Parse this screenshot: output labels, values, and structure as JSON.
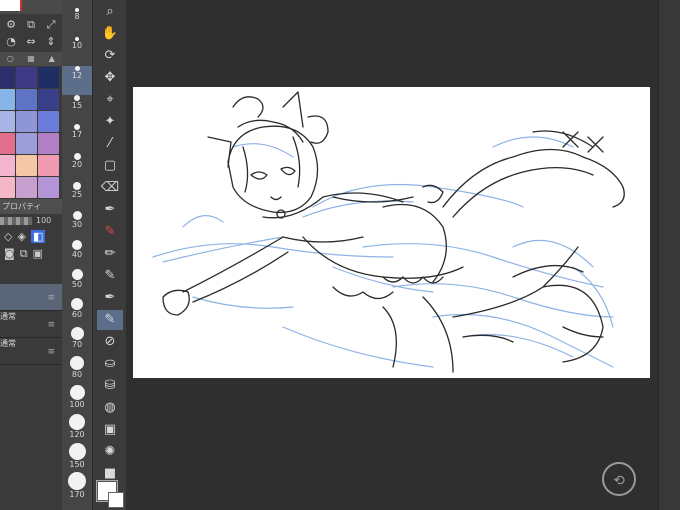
{
  "left_panel": {
    "tool_icons": [
      "gear-icon",
      "copy-icon",
      "expand-icon",
      "info-icon",
      "flip-horizontal-icon",
      "flip-vertical-icon"
    ],
    "tabs": [
      "○",
      "▦",
      "▲"
    ],
    "swatches": [
      "#2b2f6e",
      "#3f3a85",
      "#1f2f66",
      "#86b6e8",
      "#5f73c4",
      "#3a3f8a",
      "#a9b5e6",
      "#8e96d8",
      "#6b7cdb",
      "#e36f8c",
      "#9c9dd8",
      "#b27fc6",
      "#f5b5cf",
      "#f5c7a6",
      "#f19bb3",
      "#f3b7c7",
      "#c8a0d0",
      "#b394d6"
    ],
    "property_header": "プロパティ",
    "opacity_value": "100",
    "layers": [
      {
        "label": "",
        "selected": true
      },
      {
        "label": "通常",
        "selected": false
      },
      {
        "label": "通常",
        "selected": false
      }
    ]
  },
  "brush_sizes": [
    "8",
    "10",
    "12",
    "15",
    "17",
    "20",
    "25",
    "30",
    "40",
    "50",
    "60",
    "70",
    "80",
    "100",
    "120",
    "150",
    "170"
  ],
  "selected_brush_size": "12",
  "tools": [
    "zoom-icon",
    "hand-icon",
    "rotate-view-icon",
    "move-icon",
    "operation-icon",
    "magic-wand-icon",
    "eyedropper-icon",
    "selection-rect-icon",
    "eraser-icon",
    "pen-icon",
    "red-pen-icon",
    "pencil-icon",
    "marker-icon",
    "g-pen-icon",
    "brush-selected-icon",
    "blend-icon",
    "fill-bucket-icon",
    "paint-bucket-icon",
    "water-drops-icon",
    "gradient-icon",
    "burst-icon",
    "square-icon"
  ],
  "colors": {
    "main": "#ffffff",
    "sub": "#ffffff",
    "selection": "#5c6e8a"
  }
}
